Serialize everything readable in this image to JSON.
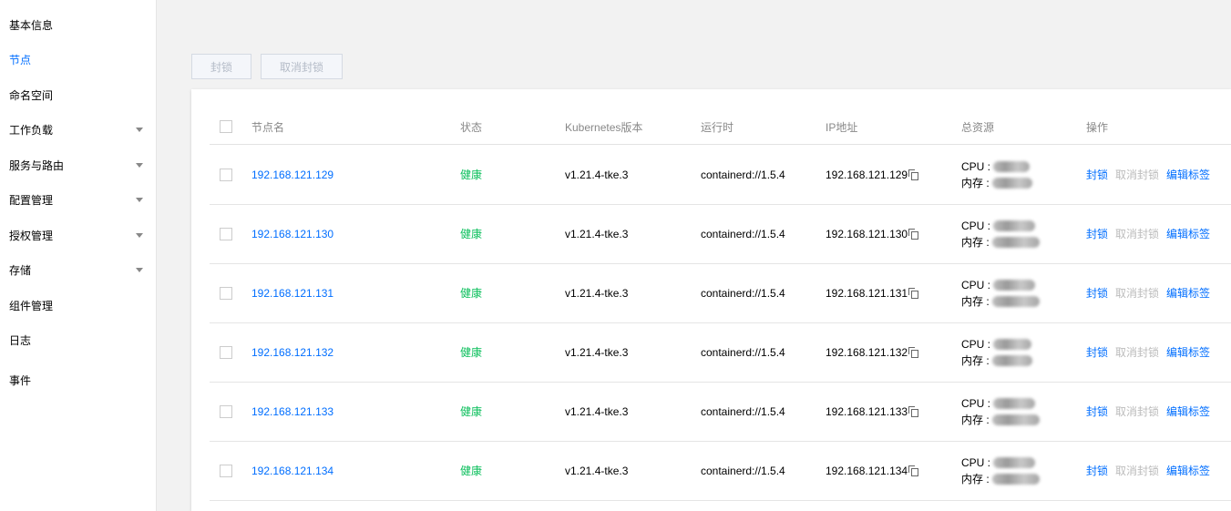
{
  "sidebar": {
    "items": [
      {
        "label": "基本信息",
        "active": false,
        "expandable": false
      },
      {
        "label": "节点",
        "active": true,
        "expandable": false
      },
      {
        "label": "命名空间",
        "active": false,
        "expandable": false
      },
      {
        "label": "工作负载",
        "active": false,
        "expandable": true
      },
      {
        "label": "服务与路由",
        "active": false,
        "expandable": true
      },
      {
        "label": "配置管理",
        "active": false,
        "expandable": true
      },
      {
        "label": "授权管理",
        "active": false,
        "expandable": true
      },
      {
        "label": "存储",
        "active": false,
        "expandable": true
      },
      {
        "label": "组件管理",
        "active": false,
        "expandable": false
      },
      {
        "label": "日志",
        "active": false,
        "expandable": false
      },
      {
        "label": "事件",
        "active": false,
        "expandable": false
      }
    ]
  },
  "toolbar": {
    "cordon_label": "封锁",
    "uncordon_label": "取消封锁"
  },
  "table": {
    "columns": [
      "节点名",
      "状态",
      "Kubernetes版本",
      "运行时",
      "IP地址",
      "总资源",
      "操作"
    ],
    "rows": [
      {
        "name": "192.168.121.129",
        "status": "健康",
        "version": "v1.21.4-tke.3",
        "runtime": "containerd://1.5.4",
        "ip": "192.168.121.129",
        "cpu_label": "CPU :",
        "mem_label": "内存 :"
      },
      {
        "name": "192.168.121.130",
        "status": "健康",
        "version": "v1.21.4-tke.3",
        "runtime": "containerd://1.5.4",
        "ip": "192.168.121.130",
        "cpu_label": "CPU :",
        "mem_label": "内存 :"
      },
      {
        "name": "192.168.121.131",
        "status": "健康",
        "version": "v1.21.4-tke.3",
        "runtime": "containerd://1.5.4",
        "ip": "192.168.121.131",
        "cpu_label": "CPU :",
        "mem_label": "内存 :"
      },
      {
        "name": "192.168.121.132",
        "status": "健康",
        "version": "v1.21.4-tke.3",
        "runtime": "containerd://1.5.4",
        "ip": "192.168.121.132",
        "cpu_label": "CPU :",
        "mem_label": "内存 :"
      },
      {
        "name": "192.168.121.133",
        "status": "健康",
        "version": "v1.21.4-tke.3",
        "runtime": "containerd://1.5.4",
        "ip": "192.168.121.133",
        "cpu_label": "CPU :",
        "mem_label": "内存 :"
      },
      {
        "name": "192.168.121.134",
        "status": "健康",
        "version": "v1.21.4-tke.3",
        "runtime": "containerd://1.5.4",
        "ip": "192.168.121.134",
        "cpu_label": "CPU :",
        "mem_label": "内存 :"
      }
    ],
    "actions": {
      "cordon": "封锁",
      "uncordon": "取消封锁",
      "edit_labels": "编辑标签"
    }
  },
  "icons": {
    "copy": "copy-icon",
    "expand": "chevron-down-icon"
  },
  "colors": {
    "accent": "#006eff",
    "healthy": "#0abf5b",
    "disabled": "#bbbbbb"
  }
}
